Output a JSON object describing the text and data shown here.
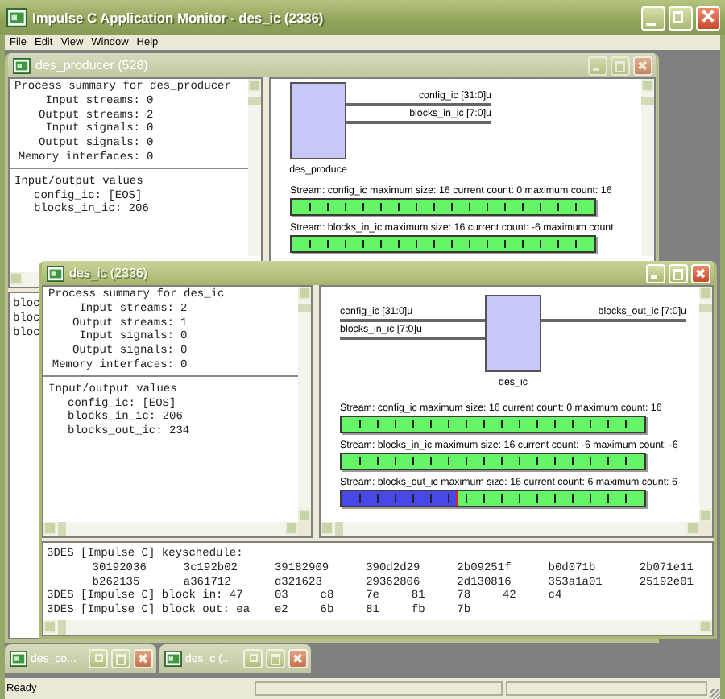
{
  "app": {
    "title": "Impulse C Application Monitor - des_ic (2336)",
    "menu": [
      "File",
      "Edit",
      "View",
      "Window",
      "Help"
    ]
  },
  "windows": [
    {
      "title": "des_producer (528)",
      "active": false,
      "summary_title": "Process summary for des_producer",
      "summary": [
        {
          "label": "Input streams:",
          "value": "0"
        },
        {
          "label": "Output streams:",
          "value": "2"
        },
        {
          "label": "Input signals:",
          "value": "0"
        },
        {
          "label": "Output signals:",
          "value": "0"
        },
        {
          "label": "Memory interfaces:",
          "value": "0"
        }
      ],
      "io_title": "Input/output values",
      "io": [
        "config_ic: [EOS]",
        "blocks_in_ic: 206"
      ],
      "block": {
        "name": "des_produce",
        "outputs": [
          "config_ic [31:0]u",
          "blocks_in_ic [7:0]u"
        ]
      },
      "streams": [
        {
          "label": "Stream: config_ic  maximum size: 16  current count: 0  maximum count: 16",
          "level": 0
        },
        {
          "label": "Stream: blocks_in_ic  maximum size: 16  current count: -6  maximum count:",
          "level": 0
        }
      ],
      "console": [
        {
          "kind": "text",
          "text": "bloc"
        },
        {
          "kind": "text",
          "text": "bloc"
        },
        {
          "kind": "text",
          "text": "bloc"
        }
      ]
    },
    {
      "title": "des_ic (2336)",
      "active": true,
      "summary_title": "Process summary for des_ic",
      "summary": [
        {
          "label": "Input streams:",
          "value": "2"
        },
        {
          "label": "Output streams:",
          "value": "1"
        },
        {
          "label": "Input signals:",
          "value": "0"
        },
        {
          "label": "Output signals:",
          "value": "0"
        },
        {
          "label": "Memory interfaces:",
          "value": "0"
        }
      ],
      "io_title": "Input/output values",
      "io": [
        "config_ic: [EOS]",
        "blocks_in_ic: 206",
        "blocks_out_ic: 234"
      ],
      "block": {
        "name": "des_ic",
        "inputs": [
          "config_ic [31:0]u",
          "blocks_in_ic [7:0]u"
        ],
        "outputs": [
          "blocks_out_ic [7:0]u"
        ]
      },
      "streams": [
        {
          "label": "Stream: config_ic  maximum size: 16  current count: 0  maximum count: 16",
          "level": 0
        },
        {
          "label": "Stream: blocks_in_ic  maximum size: 16  current count: -6  maximum count: -6",
          "level": 0
        },
        {
          "label": "Stream: blocks_out_ic  maximum size: 16  current count: 6  maximum count: 6",
          "level": 0.375
        }
      ],
      "console": [
        {
          "kind": "text",
          "text": "3DES [Impulse C] keyschedule:"
        },
        {
          "kind": "hex",
          "values": [
            "30192036",
            "3c192b02",
            "39182909",
            "390d2d29",
            "2b09251f",
            "b0d071b",
            "2b071e11"
          ]
        },
        {
          "kind": "hex",
          "values": [
            "b262135",
            "a361712",
            "d321623",
            "29362806",
            "2d130816",
            "353a1a01",
            "25192e01"
          ]
        },
        {
          "kind": "bytes",
          "lead": "3DES [Impulse C] block in: 47",
          "values": [
            "03",
            "c8",
            "7e",
            "81",
            "78",
            "42",
            "c4"
          ]
        },
        {
          "kind": "bytes",
          "lead": "3DES [Impulse C] block out: ea",
          "values": [
            "e2",
            "6b",
            "81",
            "fb",
            "7b"
          ]
        }
      ]
    }
  ],
  "minimized": [
    {
      "title": "des_co..."
    },
    {
      "title": "des_c (..."
    }
  ],
  "status_bar": {
    "text": "Ready"
  }
}
